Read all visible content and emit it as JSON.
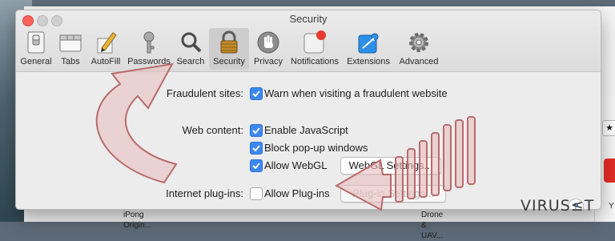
{
  "window": {
    "title": "Security"
  },
  "toolbar": {
    "tabs": [
      {
        "label": "General",
        "icon": "general-switch-icon"
      },
      {
        "label": "Tabs",
        "icon": "tabs-icon"
      },
      {
        "label": "AutoFill",
        "icon": "autofill-pencil-icon"
      },
      {
        "label": "Passwords",
        "icon": "key-icon"
      },
      {
        "label": "Search",
        "icon": "magnifier-icon"
      },
      {
        "label": "Security",
        "icon": "lock-icon",
        "active": true
      },
      {
        "label": "Privacy",
        "icon": "hand-icon"
      },
      {
        "label": "Notifications",
        "icon": "notifications-icon"
      },
      {
        "label": "Extensions",
        "icon": "puzzle-icon"
      },
      {
        "label": "Advanced",
        "icon": "gear-icon"
      }
    ]
  },
  "security": {
    "fraudulent": {
      "label": "Fraudulent sites:",
      "option": "Warn when visiting a fraudulent website",
      "checked": true
    },
    "web_content": {
      "label": "Web content:",
      "options": [
        {
          "text": "Enable JavaScript",
          "checked": true
        },
        {
          "text": "Block pop-up windows",
          "checked": true
        },
        {
          "text": "Allow WebGL",
          "checked": true
        }
      ],
      "webgl_button": "WebGL Settings..."
    },
    "plugins": {
      "label": "Internet plug-ins:",
      "option": "Allow Plug-ins",
      "checked": false,
      "button": "Plug-in Settings..."
    }
  },
  "help": {
    "label": "?"
  },
  "background": {
    "rows": [
      {
        "line1": "",
        "line2": "iPong Origin..."
      },
      {
        "line1": "",
        "line2": "Drone & UAV..."
      }
    ],
    "sidebar_star": "★",
    "sidebar_letter": "Y"
  },
  "watermark": {
    "text": "VIRUS≤T"
  },
  "colors": {
    "accent": "#3b88f0",
    "close": "#fc605b",
    "arrow": "#c98a8a"
  }
}
